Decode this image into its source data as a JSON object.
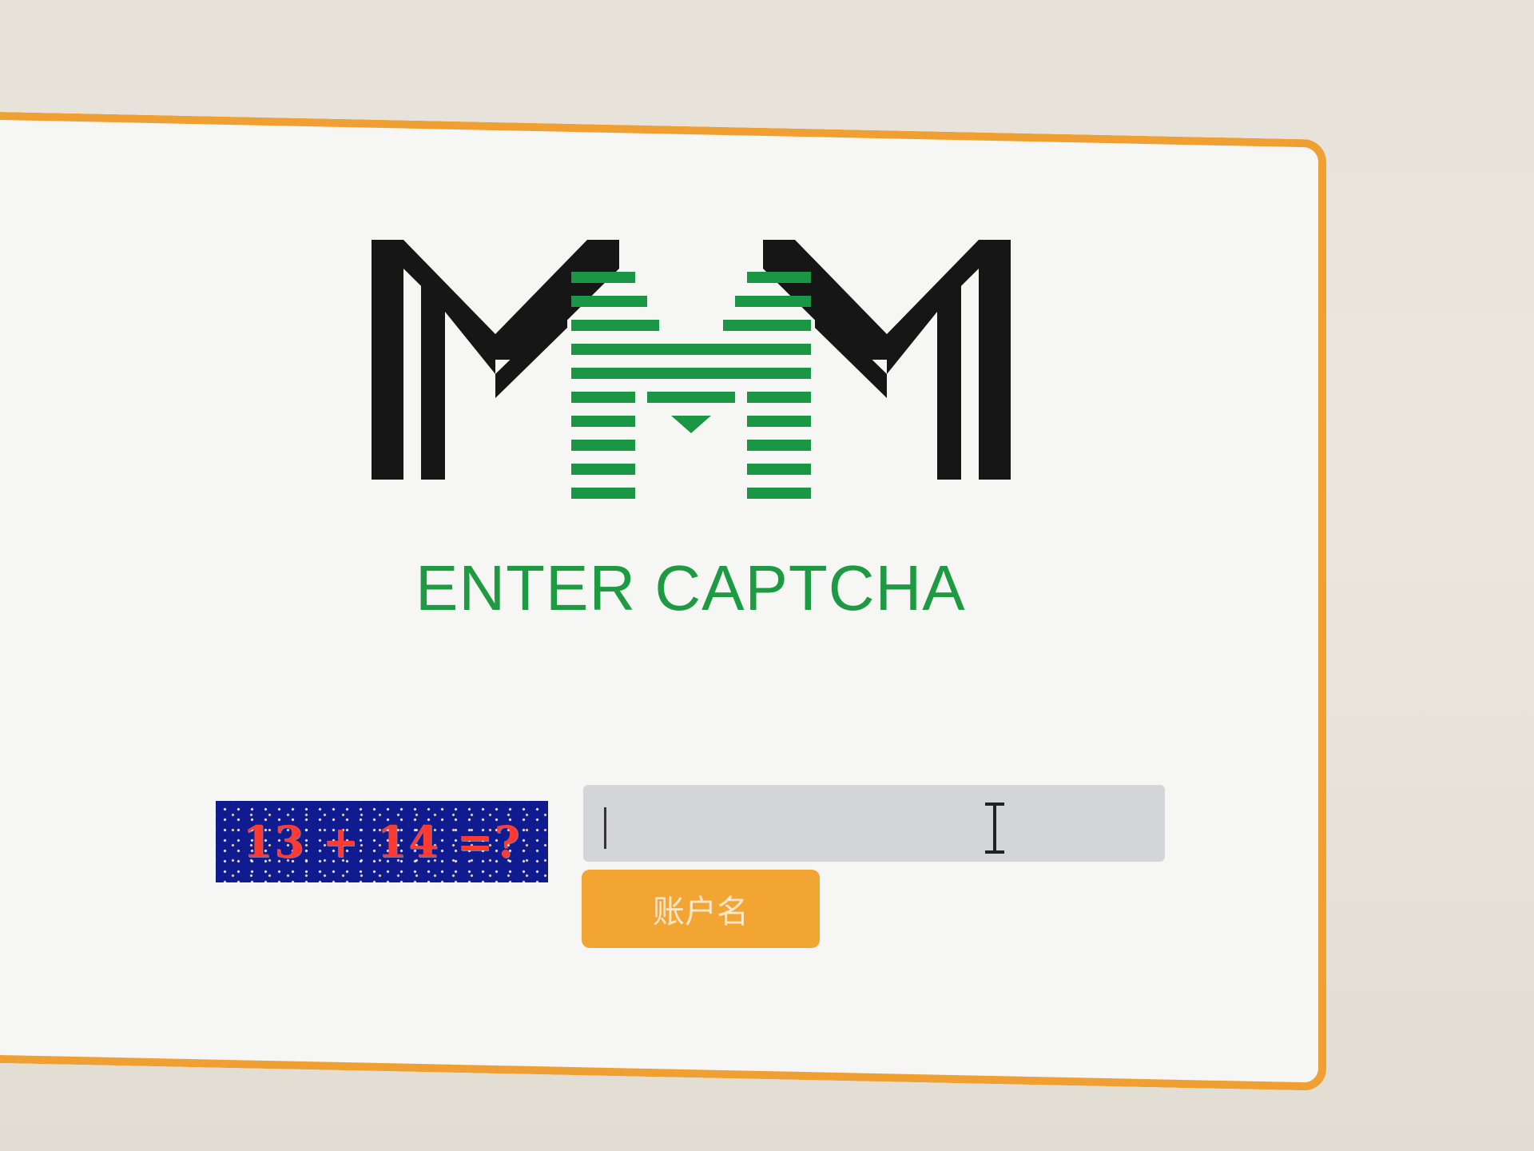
{
  "dialog": {
    "title": "ENTER CAPTCHA",
    "captcha_image_text": "13 + 14 =?",
    "input": {
      "value": "",
      "placeholder": ""
    },
    "submit_label": "账户名"
  },
  "colors": {
    "accent_border": "#f0a032",
    "title_green": "#1e9a43",
    "button_orange": "#f3a534",
    "captcha_background": "#101b8f",
    "captcha_text": "#ff3b30"
  },
  "logo": {
    "brand_mark": "MMM"
  }
}
